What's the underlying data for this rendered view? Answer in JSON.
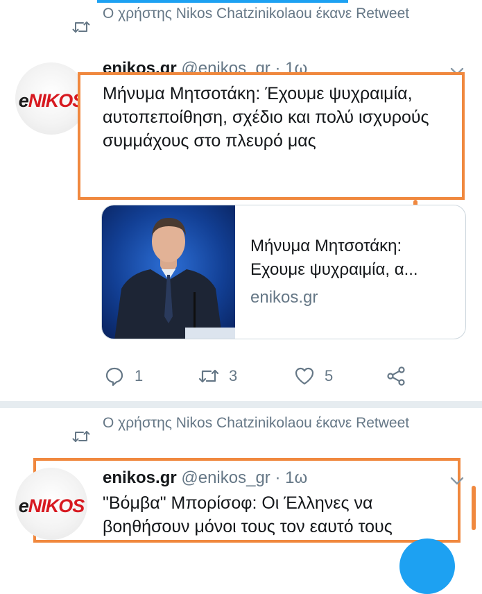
{
  "tweets": [
    {
      "retweet_text": "Ο χρήστης Nikos Chatzinikolaou έκανε Retweet",
      "author_name": "enikos.gr",
      "author_meta": "@enikos_gr · 1ω",
      "avatar_logo": "eNIKOS",
      "text": "Μήνυμα Μητσοτάκη: Έχουμε ψυχραιμία, αυτοπεποίθηση, σχέδιο και πολύ ισχυρούς συμμάχους στο πλευρό μας",
      "card": {
        "title": "Μήνυμα Μητσοτάκη:",
        "subtitle": "Εχουμε ψυχραιμία, α...",
        "domain": "enikos.gr"
      },
      "actions": {
        "replies": "1",
        "retweets": "3",
        "likes": "5"
      }
    },
    {
      "retweet_text": "Ο χρήστης Nikos Chatzinikolaou έκανε Retweet",
      "author_name": "enikos.gr",
      "author_meta": "@enikos_gr · 1ω",
      "avatar_logo": "eNIKOS",
      "text": "\"Βόμβα\" Μπορίσοφ: Οι Έλληνες να βοηθήσουν μόνοι τους τον εαυτό τους"
    }
  ],
  "colors": {
    "accent": "#1da1f2",
    "highlight": "#f0883e",
    "secondary_text": "#657786"
  },
  "icons": [
    "retweet-icon",
    "chevron-down-icon",
    "reply-icon",
    "like-icon",
    "share-icon"
  ]
}
